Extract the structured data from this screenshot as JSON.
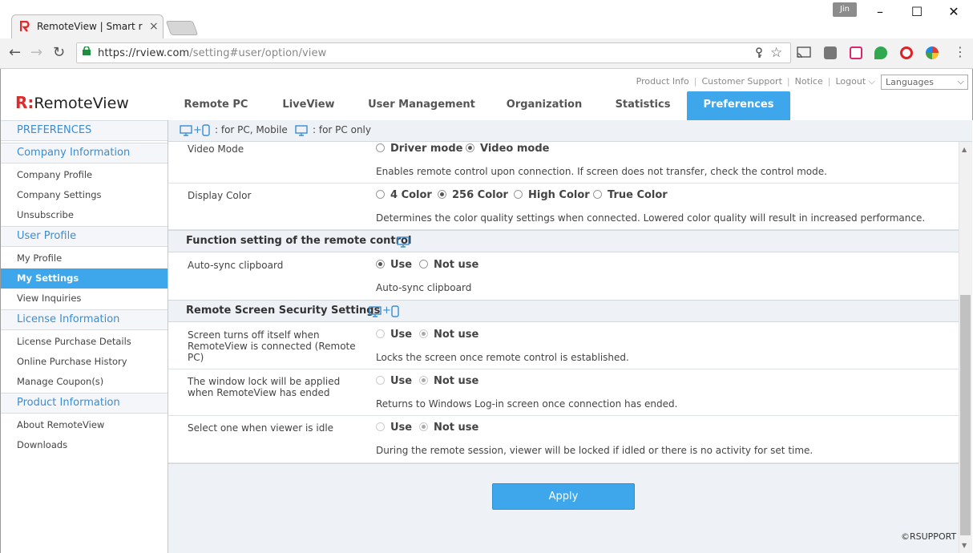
{
  "browser": {
    "tab_title": "RemoteView | Smart rem",
    "user_badge": "Jin",
    "url_domain": "https://rview.com",
    "url_path": "/setting#user/option/view"
  },
  "header": {
    "top_links": [
      "Product Info",
      "Customer Support",
      "Notice",
      "Logout"
    ],
    "language_select": "Languages",
    "logo_mark": "R:",
    "logo_text": "RemoteView",
    "nav": [
      "Remote PC",
      "LiveView",
      "User Management",
      "Organization",
      "Statistics",
      "Preferences"
    ],
    "active_nav": "Preferences",
    "accent_color": "#3ea7ec"
  },
  "sidebar": {
    "title": "PREFERENCES",
    "groups": [
      {
        "heading": "Company Information",
        "items": [
          "Company Profile",
          "Company Settings",
          "Unsubscribe"
        ]
      },
      {
        "heading": "User Profile",
        "items": [
          "My Profile",
          "My Settings",
          "View Inquiries"
        ]
      },
      {
        "heading": "License Information",
        "items": [
          "License Purchase Details",
          "Online Purchase History",
          "Manage Coupon(s)"
        ]
      },
      {
        "heading": "Product Information",
        "items": [
          "About RemoteView",
          "Downloads"
        ]
      }
    ],
    "active_item": "My Settings"
  },
  "legend": {
    "pc_mobile": ": for PC, Mobile",
    "pc_only": ": for PC only"
  },
  "settings": {
    "video_mode": {
      "label": "Video Mode",
      "options": [
        "Driver mode",
        "Video mode"
      ],
      "selected": "Video mode",
      "description": "Enables remote control upon connection. If screen does not transfer, check the control mode."
    },
    "display_color": {
      "label": "Display Color",
      "options": [
        "4 Color",
        "256 Color",
        "High Color",
        "True Color"
      ],
      "selected": "256 Color",
      "description": "Determines the color quality settings when connected. Lowered color quality will result in increased performance."
    },
    "section_remote_control": "Function setting of the remote control",
    "auto_sync": {
      "label": "Auto-sync clipboard",
      "options": [
        "Use",
        "Not use"
      ],
      "selected": "Use",
      "description": "Auto-sync clipboard"
    },
    "section_security": "Remote Screen Security Settings",
    "screen_off": {
      "label": "Screen turns off itself when RemoteView is connected (Remote PC)",
      "options": [
        "Use",
        "Not use"
      ],
      "selected": "Not use",
      "description": "Locks the screen once remote control is established."
    },
    "window_lock": {
      "label": "The window lock will be applied when RemoteView has ended",
      "options": [
        "Use",
        "Not use"
      ],
      "selected": "Not use",
      "description": "Returns to Windows Log-in screen once connection has ended."
    },
    "idle_lock": {
      "label": "Select one when viewer is idle",
      "options": [
        "Use",
        "Not use"
      ],
      "selected": "Not use",
      "description": "During the remote session, viewer will be locked if idled or there is no activity for set time."
    }
  },
  "apply_label": "Apply",
  "copyright": "©RSUPPORT"
}
